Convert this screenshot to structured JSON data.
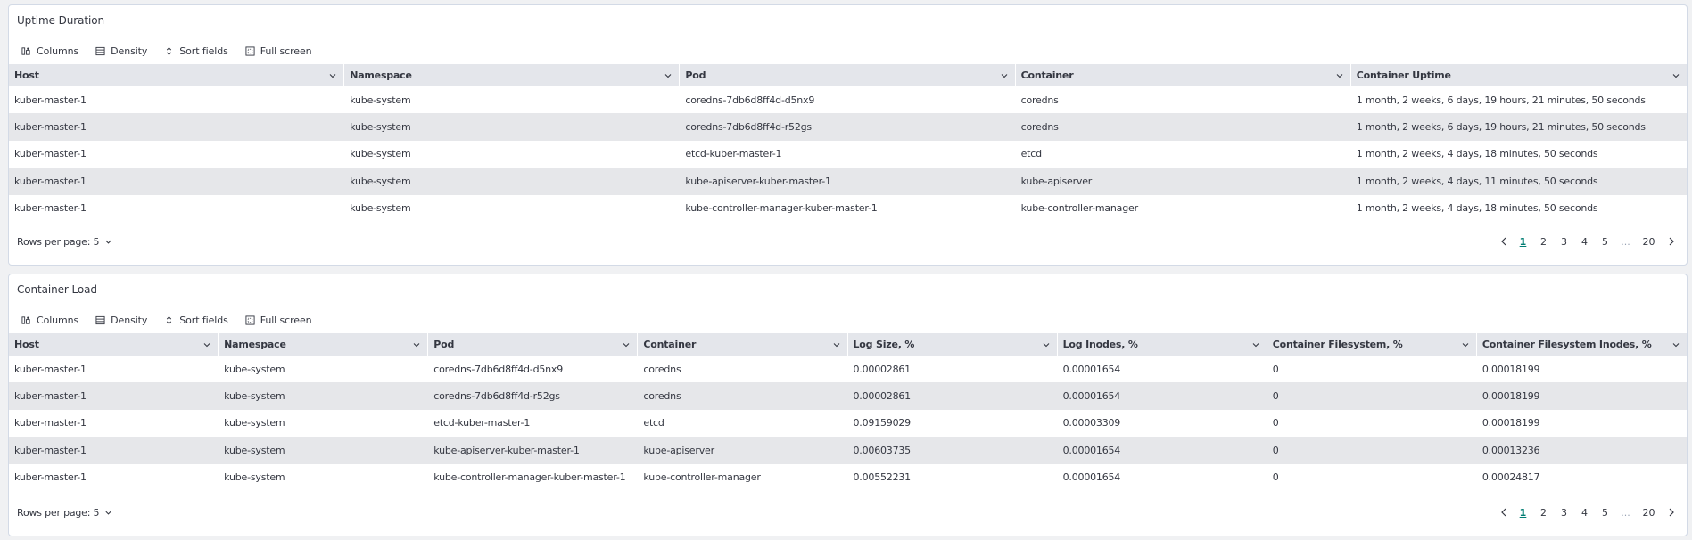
{
  "toolbar": {
    "columns_label": "Columns",
    "density_label": "Density",
    "sort_label": "Sort fields",
    "fullscreen_label": "Full screen"
  },
  "pagination": {
    "rows_per_page_label": "Rows per page: 5",
    "pages": [
      "1",
      "2",
      "3",
      "4",
      "5",
      "...",
      "20"
    ],
    "current_page": "1"
  },
  "uptime": {
    "title": "Uptime Duration",
    "columns": [
      "Host",
      "Namespace",
      "Pod",
      "Container",
      "Container Uptime"
    ],
    "rows": [
      [
        "kuber-master-1",
        "kube-system",
        "coredns-7db6d8ff4d-d5nx9",
        "coredns",
        "1 month, 2 weeks, 6 days, 19 hours, 21 minutes, 50 seconds"
      ],
      [
        "kuber-master-1",
        "kube-system",
        "coredns-7db6d8ff4d-r52gs",
        "coredns",
        "1 month, 2 weeks, 6 days, 19 hours, 21 minutes, 50 seconds"
      ],
      [
        "kuber-master-1",
        "kube-system",
        "etcd-kuber-master-1",
        "etcd",
        "1 month, 2 weeks, 4 days, 18 minutes, 50 seconds"
      ],
      [
        "kuber-master-1",
        "kube-system",
        "kube-apiserver-kuber-master-1",
        "kube-apiserver",
        "1 month, 2 weeks, 4 days, 11 minutes, 50 seconds"
      ],
      [
        "kuber-master-1",
        "kube-system",
        "kube-controller-manager-kuber-master-1",
        "kube-controller-manager",
        "1 month, 2 weeks, 4 days, 18 minutes, 50 seconds"
      ]
    ]
  },
  "load": {
    "title": "Container Load",
    "columns": [
      "Host",
      "Namespace",
      "Pod",
      "Container",
      "Log Size, %",
      "Log Inodes, %",
      "Container Filesystem, %",
      "Container Filesystem Inodes, %"
    ],
    "rows": [
      [
        "kuber-master-1",
        "kube-system",
        "coredns-7db6d8ff4d-d5nx9",
        "coredns",
        "0.00002861",
        "0.00001654",
        "0",
        "0.00018199"
      ],
      [
        "kuber-master-1",
        "kube-system",
        "coredns-7db6d8ff4d-r52gs",
        "coredns",
        "0.00002861",
        "0.00001654",
        "0",
        "0.00018199"
      ],
      [
        "kuber-master-1",
        "kube-system",
        "etcd-kuber-master-1",
        "etcd",
        "0.09159029",
        "0.00003309",
        "0",
        "0.00018199"
      ],
      [
        "kuber-master-1",
        "kube-system",
        "kube-apiserver-kuber-master-1",
        "kube-apiserver",
        "0.00603735",
        "0.00001654",
        "0",
        "0.00013236"
      ],
      [
        "kuber-master-1",
        "kube-system",
        "kube-controller-manager-kuber-master-1",
        "kube-controller-manager",
        "0.00552231",
        "0.00001654",
        "0",
        "0.00024817"
      ]
    ]
  },
  "icons": {
    "columns": "columns-icon",
    "density": "density-icon",
    "sort": "sort-icon",
    "fullscreen": "fullscreen-icon",
    "column_menu": "chevron-down-icon",
    "prev": "chevron-left-icon",
    "next": "chevron-right-icon"
  },
  "colors": {
    "header_bg": "#e4e6eb",
    "alt_row_bg": "#e6e7ea",
    "active_page": "#017d73"
  }
}
